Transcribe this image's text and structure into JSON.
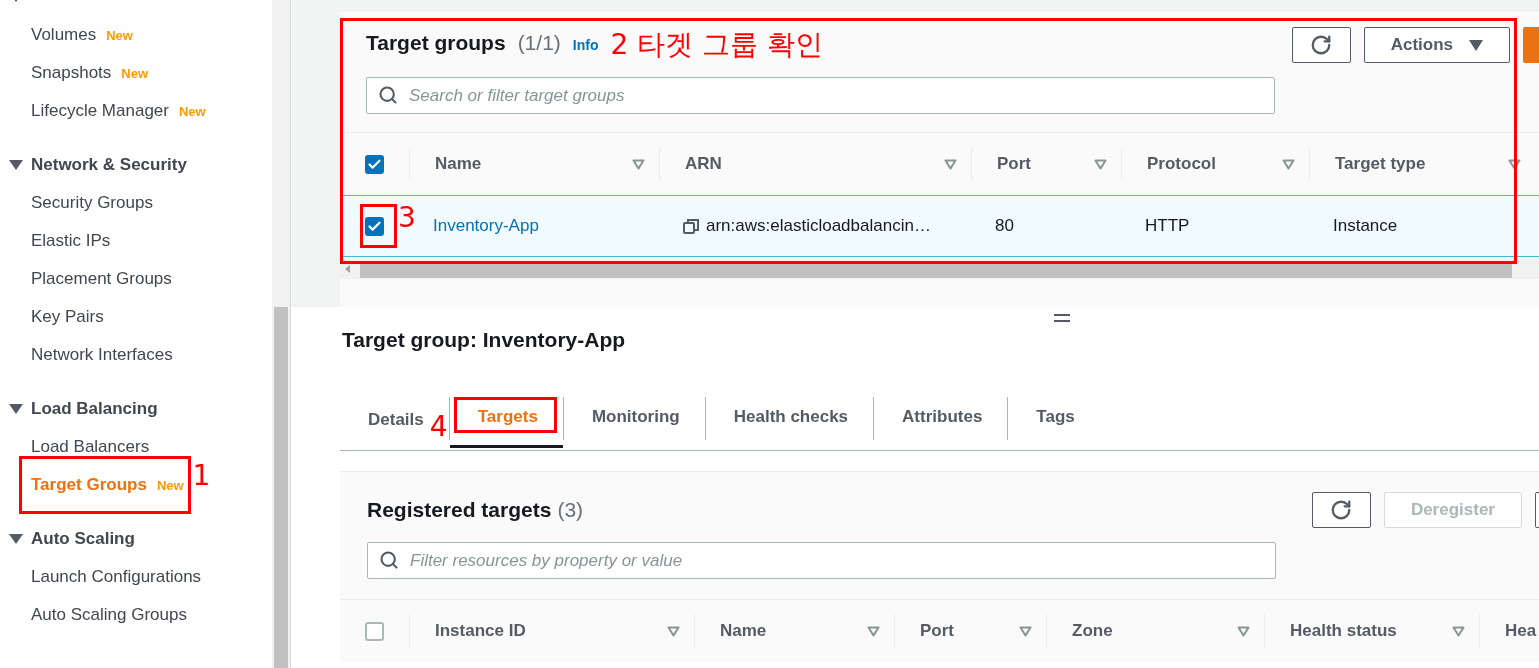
{
  "sidebar": {
    "sections": [
      {
        "expanded": true,
        "items": [
          {
            "label": "Volumes",
            "badge": "New",
            "selected": false
          },
          {
            "label": "Snapshots",
            "badge": "New",
            "selected": false
          },
          {
            "label": "Lifecycle Manager",
            "badge": "New",
            "selected": false
          }
        ]
      },
      {
        "title": "Network & Security",
        "expanded": true,
        "items": [
          {
            "label": "Security Groups",
            "selected": false
          },
          {
            "label": "Elastic IPs",
            "selected": false
          },
          {
            "label": "Placement Groups",
            "selected": false
          },
          {
            "label": "Key Pairs",
            "selected": false
          },
          {
            "label": "Network Interfaces",
            "selected": false
          }
        ]
      },
      {
        "title": "Load Balancing",
        "expanded": true,
        "items": [
          {
            "label": "Load Balancers",
            "selected": false
          },
          {
            "label": "Target Groups",
            "badge": "New",
            "selected": true,
            "annotation": "1"
          }
        ]
      },
      {
        "title": "Auto Scaling",
        "expanded": true,
        "items": [
          {
            "label": "Launch Configurations",
            "selected": false
          },
          {
            "label": "Auto Scaling Groups",
            "selected": false
          }
        ]
      }
    ]
  },
  "target_groups": {
    "title": "Target groups",
    "count": "(1/1)",
    "info": "Info",
    "annotation": "2 타겟 그룹 확인",
    "actions": "Actions",
    "search": {
      "placeholder": "Search or filter target groups"
    },
    "header_checked": true,
    "columns": [
      {
        "label": "Name"
      },
      {
        "label": "ARN"
      },
      {
        "label": "Port"
      },
      {
        "label": "Protocol"
      },
      {
        "label": "Target type"
      }
    ],
    "rows": [
      {
        "checked": true,
        "selected": true,
        "annotation": "3",
        "cells": [
          {
            "kind": "link",
            "text": "Inventory-App"
          },
          {
            "kind": "copyable",
            "text": "arn:aws:elasticloadbalancin…"
          },
          {
            "kind": "text",
            "text": "80"
          },
          {
            "kind": "text",
            "text": "HTTP"
          },
          {
            "kind": "text",
            "text": "Instance"
          }
        ]
      }
    ]
  },
  "detail": {
    "title": "Target group: Inventory-App",
    "tabs": [
      {
        "label": "Details",
        "selected": false
      },
      {
        "label": "Targets",
        "selected": true,
        "annotation": "4"
      },
      {
        "label": "Monitoring",
        "selected": false
      },
      {
        "label": "Health checks",
        "selected": false
      },
      {
        "label": "Attributes",
        "selected": false
      },
      {
        "label": "Tags",
        "selected": false
      }
    ],
    "registered": {
      "title": "Registered targets",
      "count": "(3)",
      "deregister": {
        "label": "Deregister",
        "disabled": true
      },
      "filter": {
        "placeholder": "Filter resources by property or value"
      },
      "header_checked": false,
      "columns": [
        {
          "label": "Instance ID"
        },
        {
          "label": "Name"
        },
        {
          "label": "Port"
        },
        {
          "label": "Zone"
        },
        {
          "label": "Health status"
        },
        {
          "label": "Hea",
          "filter": false
        }
      ]
    }
  }
}
